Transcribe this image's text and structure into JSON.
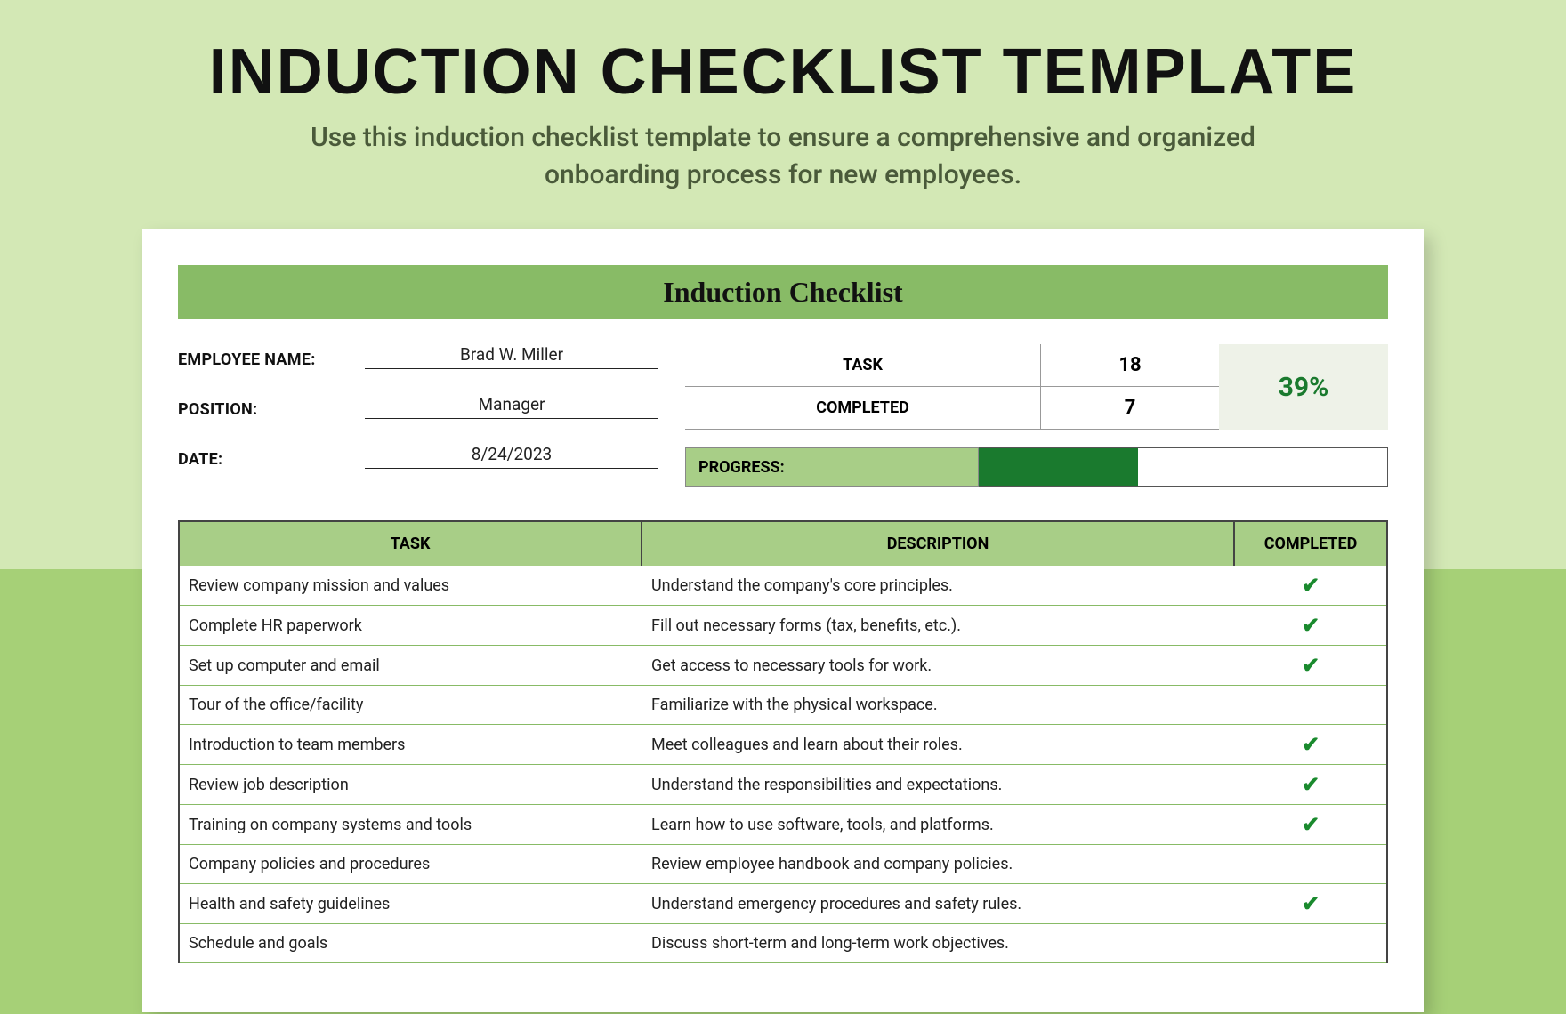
{
  "header": {
    "title": "INDUCTION CHECKLIST TEMPLATE",
    "subtitle_line1": "Use this induction checklist template to ensure a comprehensive and organized",
    "subtitle_line2": "onboarding process for new employees."
  },
  "sheet": {
    "title": "Induction Checklist",
    "labels": {
      "employee_name": "EMPLOYEE NAME:",
      "position": "POSITION:",
      "date": "DATE:",
      "task": "TASK",
      "completed": "COMPLETED",
      "progress": "PROGRESS:"
    },
    "employee_name": "Brad W. Miller",
    "position": "Manager",
    "date": "8/24/2023",
    "stats": {
      "task_count": "18",
      "completed_count": "7",
      "percent": "39%"
    },
    "progress_fill_pct": 39,
    "columns": {
      "task": "TASK",
      "description": "DESCRIPTION",
      "completed": "COMPLETED"
    },
    "rows": [
      {
        "task": "Review company mission and values",
        "description": "Understand the company's core principles.",
        "completed": true
      },
      {
        "task": "Complete HR paperwork",
        "description": "Fill out necessary forms (tax, benefits, etc.).",
        "completed": true
      },
      {
        "task": "Set up computer and email",
        "description": "Get access to necessary tools for work.",
        "completed": true
      },
      {
        "task": "Tour of the office/facility",
        "description": "Familiarize with the physical workspace.",
        "completed": false
      },
      {
        "task": "Introduction to team members",
        "description": "Meet colleagues and learn about their roles.",
        "completed": true
      },
      {
        "task": "Review job description",
        "description": "Understand the responsibilities and expectations.",
        "completed": true
      },
      {
        "task": "Training on company systems and tools",
        "description": "Learn how to use software, tools, and platforms.",
        "completed": true
      },
      {
        "task": "Company policies and procedures",
        "description": "Review employee handbook and company policies.",
        "completed": false
      },
      {
        "task": "Health and safety guidelines",
        "description": "Understand emergency procedures and safety rules.",
        "completed": true
      },
      {
        "task": "Schedule and goals",
        "description": "Discuss short-term and long-term work objectives.",
        "completed": false
      }
    ],
    "check_glyph": "✔"
  }
}
